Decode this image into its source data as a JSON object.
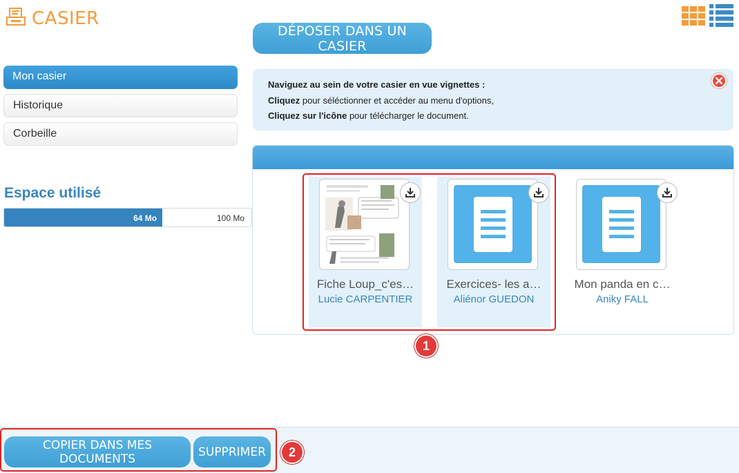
{
  "header": {
    "title": "CASIER",
    "title_icon": "printer-tray-icon",
    "grid_view_icon": "grid-view-icon",
    "list_view_icon": "list-view-icon"
  },
  "deposit_button": "DÉPOSER DANS UN CASIER",
  "sidebar": {
    "items": [
      {
        "label": "Mon casier",
        "active": true
      },
      {
        "label": "Historique",
        "active": false
      },
      {
        "label": "Corbeille",
        "active": false
      }
    ]
  },
  "storage": {
    "title": "Espace utilisé",
    "used_label": "64 Mo",
    "total_label": "100 Mo",
    "used_fraction": 0.64
  },
  "info": {
    "heading": "Naviguez au sein de votre casier en vue vignettes :",
    "line1_bold": "Cliquez",
    "line1_rest": " pour séléctionner et accéder au menu d'options,",
    "line2_bold": "Cliquez sur l'icône",
    "line2_rest": " pour télécharger le document."
  },
  "files": [
    {
      "name": "Fiche Loup_c'es…",
      "author": "Lucie CARPENTIER",
      "selected": true,
      "thumb": "comic-page"
    },
    {
      "name": "Exercices- les a…",
      "author": "Aliénor GUEDON",
      "selected": true,
      "thumb": "document-icon"
    },
    {
      "name": "Mon panda en c…",
      "author": "Aniky FALL",
      "selected": false,
      "thumb": "document-icon"
    }
  ],
  "markers": [
    "1",
    "2"
  ],
  "footer": {
    "copy_label": "COPIER DANS MES DOCUMENTS",
    "delete_label": "SUPPRIMER"
  },
  "colors": {
    "brand_orange": "#f39c3c",
    "primary_blue": "#3f9fd6",
    "highlight_red": "#e02424"
  }
}
